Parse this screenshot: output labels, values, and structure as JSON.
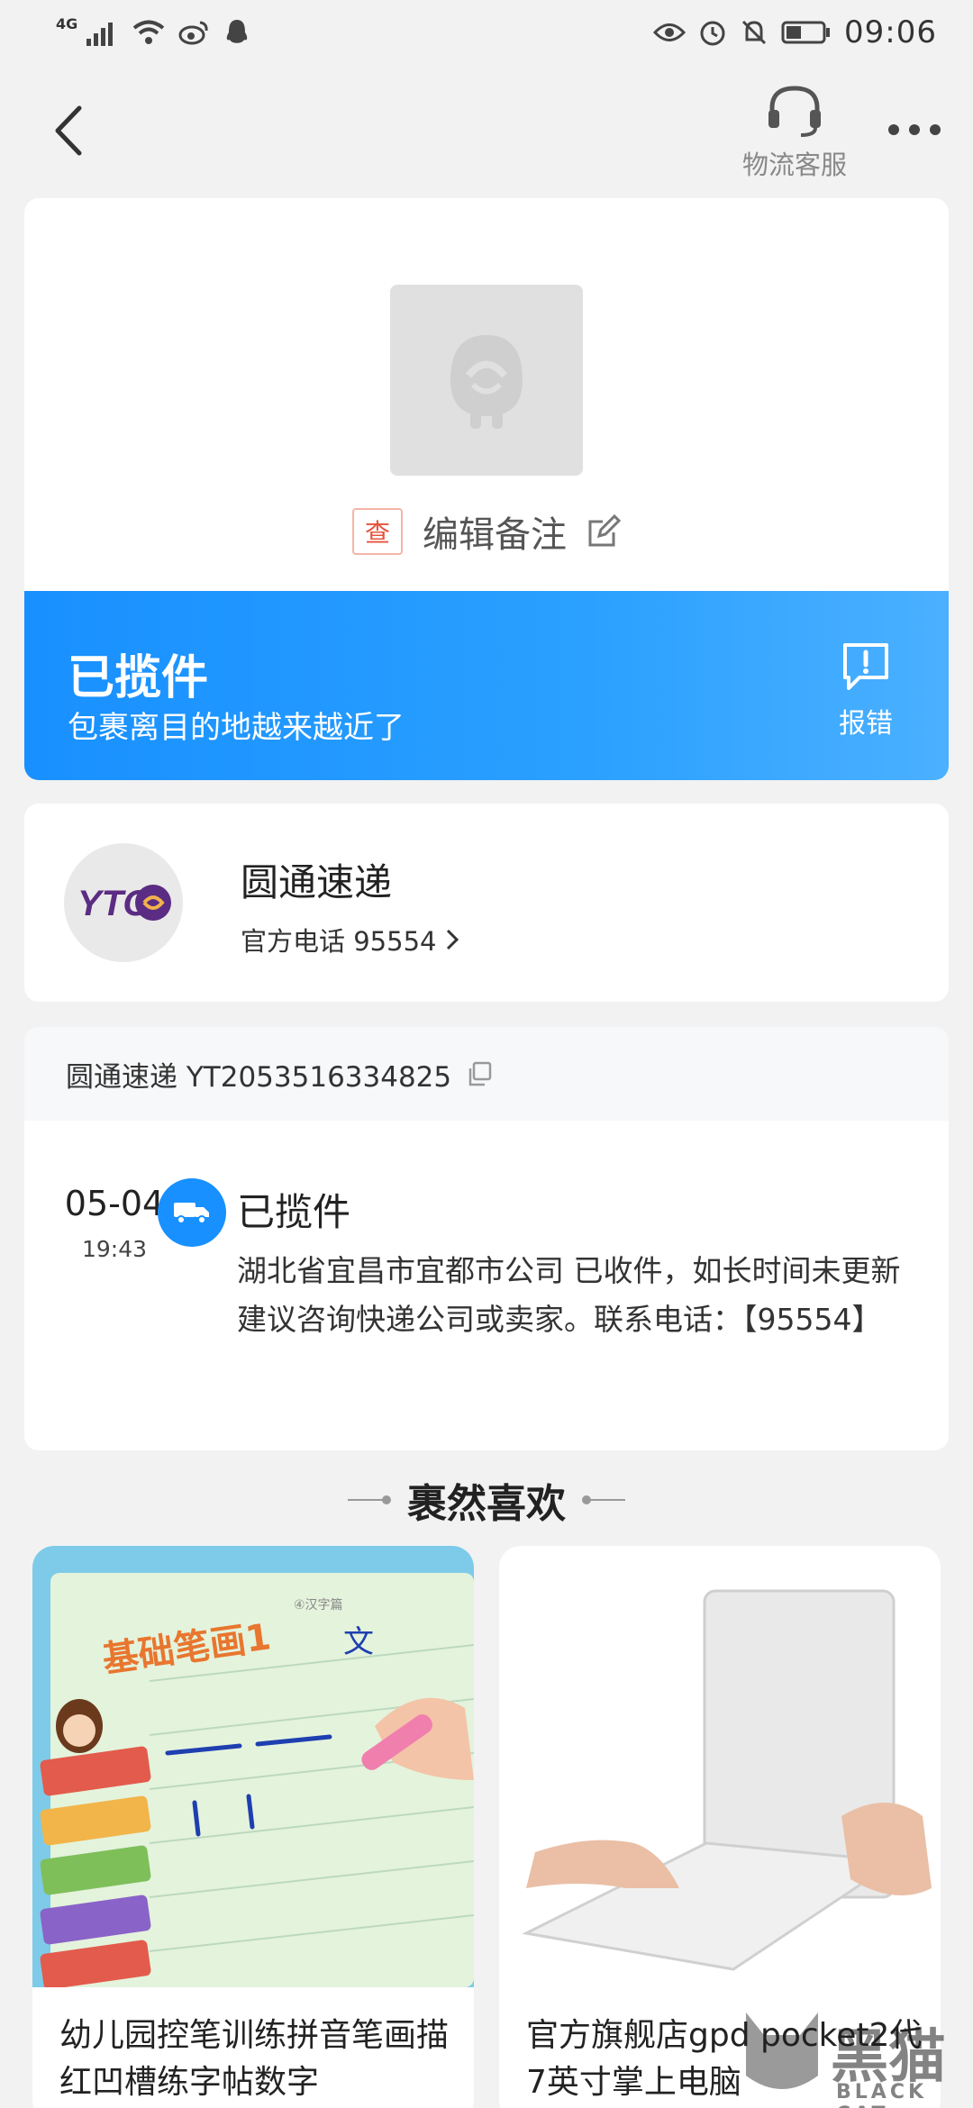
{
  "status_bar": {
    "network": "4G",
    "time": "09:06"
  },
  "nav": {
    "service_label": "物流客服"
  },
  "package": {
    "tag": "查",
    "note_label": "编辑备注"
  },
  "status": {
    "title": "已揽件",
    "subtitle": "包裹离目的地越来越近了",
    "report_label": "报错"
  },
  "courier": {
    "logo_text": "YTO",
    "name": "圆通速递",
    "phone_label": "官方电话 95554"
  },
  "tracking": {
    "header": "圆通速递 YT2053516334825",
    "events": [
      {
        "date": "05-04",
        "time": "19:43",
        "title": "已揽件",
        "desc": "湖北省宜昌市宜都市公司 已收件，如长时间未更新建议咨询快递公司或卖家。联系电话：【95554】"
      }
    ]
  },
  "recommend": {
    "title": "裹然喜欢",
    "products": [
      {
        "name": "幼儿园控笔训练拼音笔画描红凹槽练字帖数字",
        "book_title": "基础笔画1",
        "book_corner": "④汉字篇",
        "grid_char": "文"
      },
      {
        "name": "官方旗舰店gpd pocket2代7英寸掌上电脑"
      }
    ]
  },
  "watermark": {
    "text": "黑猫",
    "sub": "BLACK CAT"
  },
  "colors": {
    "accent": "#1890ff",
    "page_bg": "#f2f2f2",
    "tag_red": "#e5533c"
  }
}
